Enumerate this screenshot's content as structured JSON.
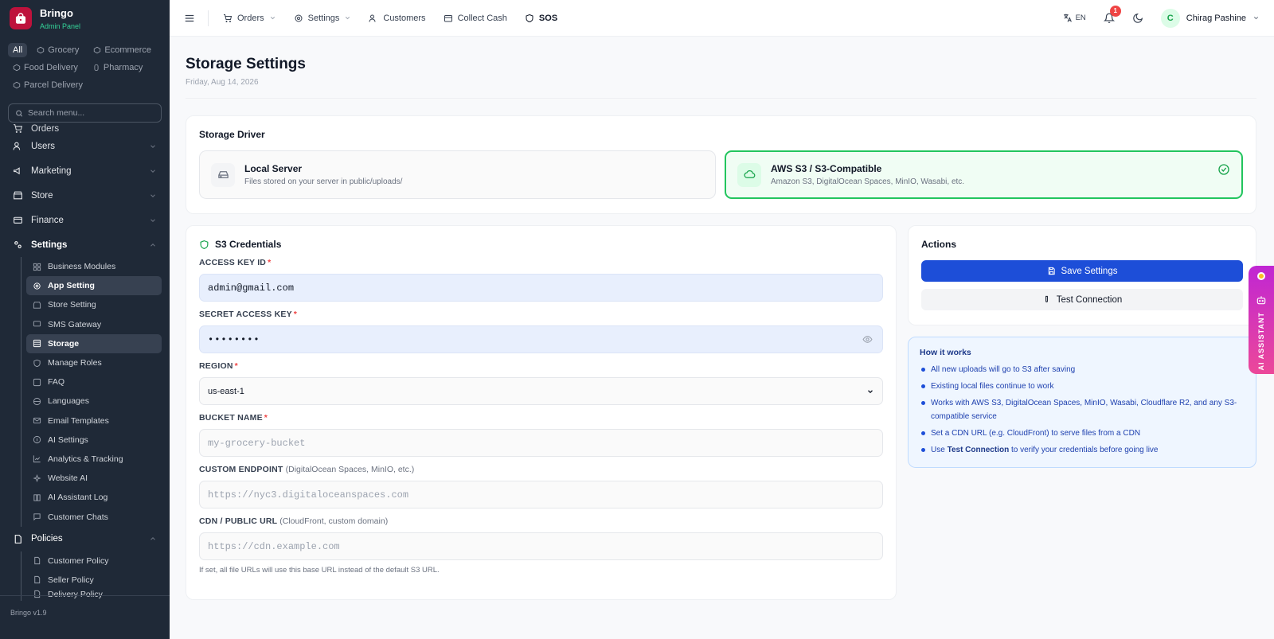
{
  "brand": {
    "name": "Bringo",
    "subtitle": "Admin Panel",
    "version": "Bringo v1.9"
  },
  "modules": [
    {
      "label": "All",
      "active": true
    },
    {
      "label": "Grocery"
    },
    {
      "label": "Ecommerce"
    },
    {
      "label": "Food Delivery"
    },
    {
      "label": "Pharmacy"
    },
    {
      "label": "Parcel Delivery"
    }
  ],
  "search": {
    "placeholder": "Search menu..."
  },
  "menu": {
    "orders": "Orders",
    "users": "Users",
    "marketing": "Marketing",
    "store": "Store",
    "finance": "Finance",
    "settings": "Settings",
    "settings_sub": [
      "Business Modules",
      "App Setting",
      "Store Setting",
      "SMS Gateway",
      "Storage",
      "Manage Roles",
      "FAQ",
      "Languages",
      "Email Templates",
      "AI Settings",
      "Analytics & Tracking",
      "Website AI",
      "AI Assistant Log",
      "Customer Chats"
    ],
    "policies": "Policies",
    "policies_sub": [
      "Customer Policy",
      "Seller Policy",
      "Delivery Policy"
    ]
  },
  "topbar": {
    "nav": [
      "Orders",
      "Settings",
      "Customers",
      "Collect Cash",
      "SOS"
    ],
    "lang": "EN",
    "notifications": "1",
    "user_initial": "C",
    "user_name": "Chirag Pashine"
  },
  "page": {
    "title": "Storage Settings",
    "date": "Friday, Aug 14, 2026"
  },
  "driver": {
    "title": "Storage Driver",
    "options": [
      {
        "name": "Local Server",
        "desc": "Files stored on your server in public/uploads/"
      },
      {
        "name": "AWS S3 / S3-Compatible",
        "desc": "Amazon S3, DigitalOcean Spaces, MinIO, Wasabi, etc."
      }
    ]
  },
  "credentials": {
    "title": "S3 Credentials",
    "access_key_label": "ACCESS KEY ID",
    "access_key_value": "admin@gmail.com",
    "secret_label": "SECRET ACCESS KEY",
    "secret_value": "••••••••",
    "region_label": "REGION",
    "region_value": "us-east-1",
    "bucket_label": "BUCKET NAME",
    "bucket_placeholder": "my-grocery-bucket",
    "endpoint_label": "CUSTOM ENDPOINT",
    "endpoint_hint": "(DigitalOcean Spaces, MinIO, etc.)",
    "endpoint_placeholder": "https://nyc3.digitaloceanspaces.com",
    "cdn_label": "CDN / PUBLIC URL",
    "cdn_hint": "(CloudFront, custom domain)",
    "cdn_placeholder": "https://cdn.example.com",
    "cdn_help": "If set, all file URLs will use this base URL instead of the default S3 URL."
  },
  "actions": {
    "title": "Actions",
    "save": "Save Settings",
    "test": "Test Connection"
  },
  "how": {
    "title": "How it works",
    "items": [
      "All new uploads will go to S3 after saving",
      "Existing local files continue to work",
      "Works with AWS S3, DigitalOcean Spaces, MinIO, Wasabi, Cloudflare R2, and any S3-compatible service",
      "Set a CDN URL (e.g. CloudFront) to serve files from a CDN"
    ],
    "last_prefix": "Use",
    "last_bold": "Test Connection",
    "last_suffix": "to verify your credentials before going live"
  },
  "ai_tab": "AI ASSISTANT",
  "colors": {
    "accent": "#1d4ed8",
    "success": "#22c55e",
    "sidebar": "#1f2937",
    "brand": "#be123c"
  }
}
